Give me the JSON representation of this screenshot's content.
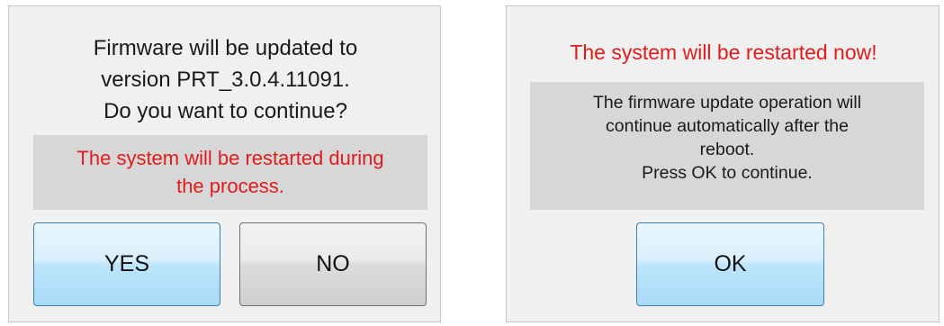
{
  "update_dialog": {
    "question_lines": [
      "Firmware will be updated to",
      "version PRT_3.0.4.11091.",
      "Do you want to continue?"
    ],
    "warning_lines": [
      "The system will be restarted during",
      "the process."
    ],
    "yes_label": "YES",
    "no_label": "NO"
  },
  "restart_dialog": {
    "title": "The system will be restarted now!",
    "info_lines": [
      "The firmware update operation will",
      "continue automatically after the",
      "reboot.",
      "Press OK to continue."
    ],
    "ok_label": "OK"
  },
  "colors": {
    "warning_text": "#e21b1b",
    "dialog_background": "#f0f0f0",
    "message_box_background": "#d7d7d7",
    "primary_button_border": "#3c7fb1"
  }
}
